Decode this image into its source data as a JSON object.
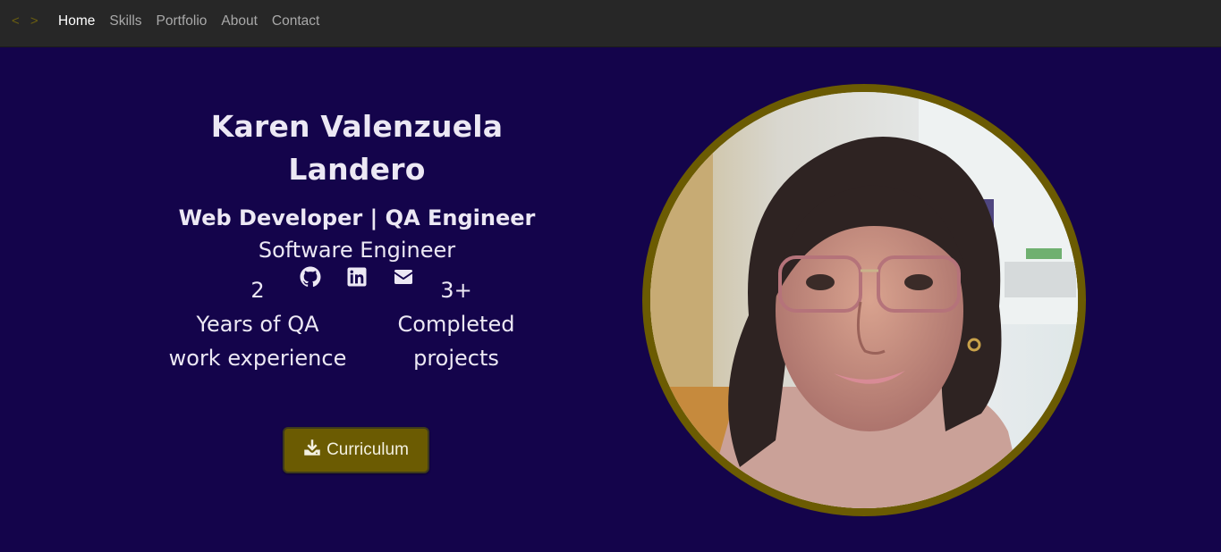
{
  "nav": {
    "brand": "< >",
    "links": [
      "Home",
      "Skills",
      "Portfolio",
      "About",
      "Contact"
    ],
    "active": "Home"
  },
  "hero": {
    "name": "Karen Valenzuela Landero",
    "role": "Web Developer | QA Engineer",
    "subtitle": "Software Engineer",
    "socials": [
      "github-icon",
      "linkedin-icon",
      "envelope-icon"
    ],
    "stats": [
      {
        "number": "2",
        "label_line1": "Years of QA",
        "label_line2": "work experience"
      },
      {
        "number": "3+",
        "label_line1": "Completed",
        "label_line2": "projects"
      }
    ],
    "cv_button": {
      "label": "Curriculum",
      "icon": "download-icon"
    }
  },
  "colors": {
    "background": "#14044b",
    "navbar": "#272727",
    "accent": "#6b5b02",
    "text": "#ece8f4"
  }
}
